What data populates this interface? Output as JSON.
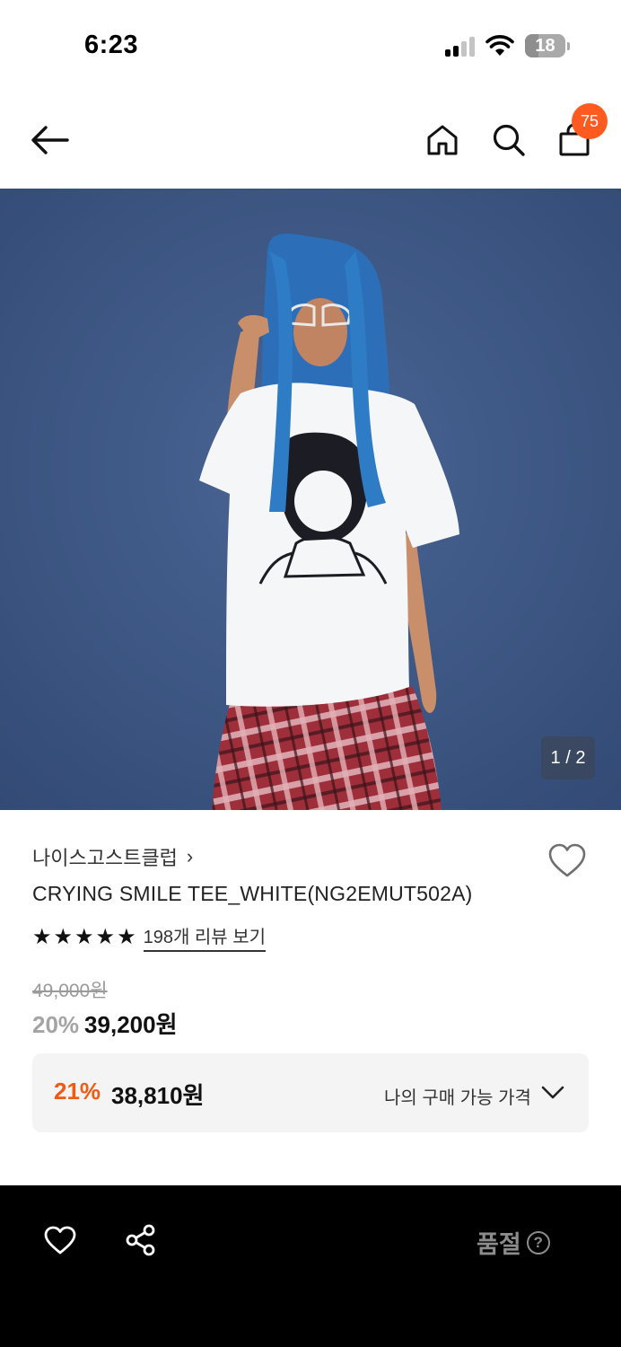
{
  "status_bar": {
    "time": "6:23",
    "battery": "18",
    "battery_level": 0.18
  },
  "nav": {
    "cart_count": "75"
  },
  "gallery": {
    "counter": "1 / 2"
  },
  "product": {
    "brand": "나이스고스트클럽",
    "brand_chevron": "›",
    "name": "CRYING SMILE TEE_WHITE(NG2EMUT502A)",
    "rating_stars": 5,
    "review_link": "198개 리뷰 보기",
    "original_price": "49,000원",
    "sale_rate": "20%",
    "sale_price": "39,200원"
  },
  "my_price": {
    "rate": "21%",
    "price": "38,810원",
    "label": "나의 구매 가능 가격"
  },
  "bottom_bar": {
    "status": "품절",
    "help": "?"
  },
  "colors": {
    "accent": "#f05a13",
    "badge": "#ff5a1f",
    "hero_background": "#3d5683"
  }
}
